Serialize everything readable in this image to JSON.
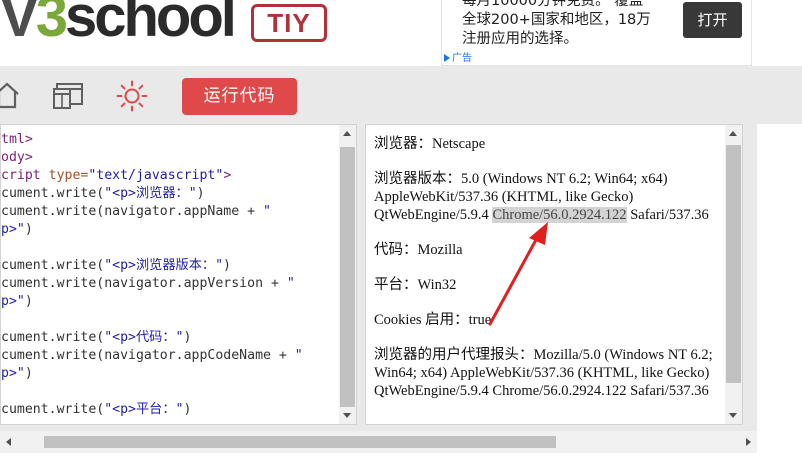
{
  "logo": {
    "prefix": "V",
    "digit": "3",
    "suffix": "school"
  },
  "tiy_label": "TIY",
  "ad": {
    "text": "每月10000分钟免费。 覆盖\n全球200+国家和地区，18万\n注册应用的选择。",
    "button_label": "打开",
    "label": "广告"
  },
  "toolbar": {
    "run_label": "运行代码",
    "icons": [
      "home-icon",
      "window-layout-icon",
      "sun-icon"
    ]
  },
  "code_lines": [
    [
      {
        "t": "tag",
        "v": "tml>"
      }
    ],
    [
      {
        "t": "tag",
        "v": "ody>"
      }
    ],
    [
      {
        "t": "tag",
        "v": "cript "
      },
      {
        "t": "attr",
        "v": "type="
      },
      {
        "t": "str",
        "v": "\"text/javascript\""
      },
      {
        "t": "tag",
        "v": ">"
      }
    ],
    [
      {
        "t": "plain",
        "v": "cument.write("
      },
      {
        "t": "str",
        "v": "\"<p>浏览器：\""
      },
      {
        "t": "plain",
        "v": ")"
      }
    ],
    [
      {
        "t": "plain",
        "v": "cument.write(navigator.appName + "
      },
      {
        "t": "str",
        "v": "\""
      }
    ],
    [
      {
        "t": "str",
        "v": "p>\""
      },
      {
        "t": "plain",
        "v": ")"
      }
    ],
    [
      {
        "t": "plain",
        "v": ""
      }
    ],
    [
      {
        "t": "plain",
        "v": "cument.write("
      },
      {
        "t": "str",
        "v": "\"<p>浏览器版本：\""
      },
      {
        "t": "plain",
        "v": ")"
      }
    ],
    [
      {
        "t": "plain",
        "v": "cument.write(navigator.appVersion + "
      },
      {
        "t": "str",
        "v": "\""
      }
    ],
    [
      {
        "t": "str",
        "v": "p>\""
      },
      {
        "t": "plain",
        "v": ")"
      }
    ],
    [
      {
        "t": "plain",
        "v": ""
      }
    ],
    [
      {
        "t": "plain",
        "v": "cument.write("
      },
      {
        "t": "str",
        "v": "\"<p>代码：\""
      },
      {
        "t": "plain",
        "v": ")"
      }
    ],
    [
      {
        "t": "plain",
        "v": "cument.write(navigator.appCodeName + "
      },
      {
        "t": "str",
        "v": "\""
      }
    ],
    [
      {
        "t": "str",
        "v": "p>\""
      },
      {
        "t": "plain",
        "v": ")"
      }
    ],
    [
      {
        "t": "plain",
        "v": ""
      }
    ],
    [
      {
        "t": "plain",
        "v": "cument.write("
      },
      {
        "t": "str",
        "v": "\"<p>平台：\""
      },
      {
        "t": "plain",
        "v": ")"
      }
    ]
  ],
  "result": {
    "browser": "浏览器：Netscape",
    "version_label": "浏览器版本：",
    "version_pre": "5.0 (Windows NT 6.2; Win64; x64) AppleWebKit/537.36 (KHTML, like Gecko) QtWebEngine/5.9.4 ",
    "version_highlight": "Chrome/56.0.2924.122",
    "version_post": " Safari/537.36",
    "code": "代码：Mozilla",
    "platform": "平台：Win32",
    "cookies": "Cookies 启用：true",
    "ua": "浏览器的用户代理报头：Mozilla/5.0 (Windows NT 6.2; Win64; x64) AppleWebKit/537.36 (KHTML, like Gecko) QtWebEngine/5.9.4 Chrome/56.0.2924.122 Safari/537.36"
  },
  "colors": {
    "run_button": "#e0494a",
    "tiy_border": "#b2303a",
    "annotation_arrow": "#e0201f"
  }
}
